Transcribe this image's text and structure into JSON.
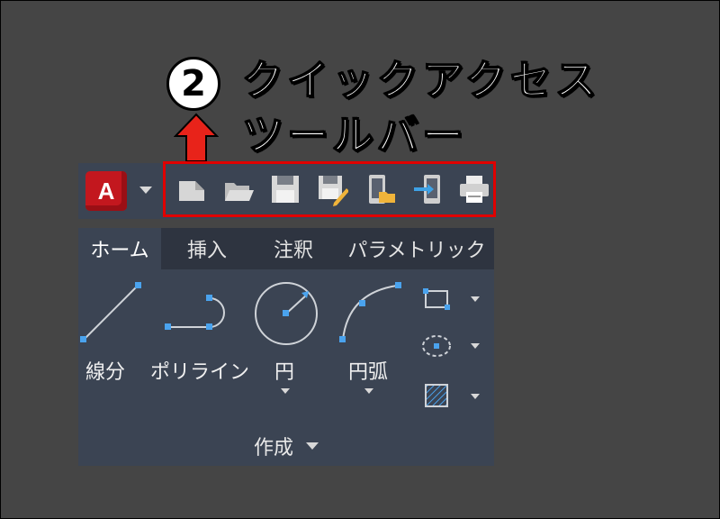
{
  "annotation": {
    "step_number": "2",
    "callout_line1": "クイックアクセス",
    "callout_line2": "ツールバー",
    "highlight_color": "#e00000"
  },
  "app": {
    "logo_letter": "A",
    "brand_color": "#c3171e"
  },
  "quick_access_toolbar": {
    "buttons": [
      {
        "icon": "new-file-icon"
      },
      {
        "icon": "open-folder-icon"
      },
      {
        "icon": "save-icon"
      },
      {
        "icon": "save-as-icon"
      },
      {
        "icon": "open-from-web-icon"
      },
      {
        "icon": "save-to-web-icon"
      },
      {
        "icon": "print-icon"
      }
    ]
  },
  "ribbon": {
    "tabs": [
      {
        "label": "ホーム",
        "active": true
      },
      {
        "label": "挿入"
      },
      {
        "label": "注釈"
      },
      {
        "label": "パラメトリック"
      }
    ],
    "panel": {
      "title": "作成",
      "tools": [
        {
          "label": "線分",
          "icon": "line-icon"
        },
        {
          "label": "ポリライン",
          "icon": "polyline-icon"
        },
        {
          "label": "円",
          "icon": "circle-icon"
        },
        {
          "label": "円弧",
          "icon": "arc-icon"
        }
      ],
      "small_tools": [
        {
          "icon": "rectangle-icon"
        },
        {
          "icon": "ellipse-icon"
        },
        {
          "icon": "hatch-icon"
        }
      ]
    }
  }
}
